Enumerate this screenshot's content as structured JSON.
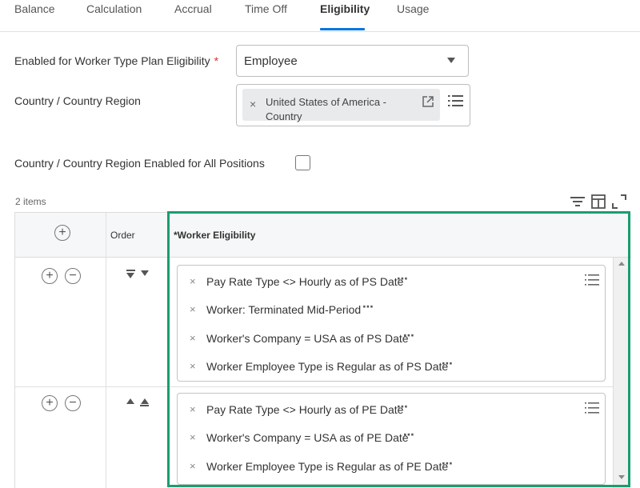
{
  "tabs": [
    {
      "label": "Balance"
    },
    {
      "label": "Calculation"
    },
    {
      "label": "Accrual"
    },
    {
      "label": "Time Off"
    },
    {
      "label": "Eligibility",
      "active": true
    },
    {
      "label": "Usage"
    }
  ],
  "form": {
    "worker_type_label": "Enabled for Worker Type Plan Eligibility",
    "required_mark": "*",
    "worker_type_value": "Employee",
    "country_label": "Country / Country Region",
    "country_pill": "United States of America - Country",
    "all_positions_label": "Country / Country Region Enabled for All Positions",
    "all_positions_checked": false
  },
  "grid": {
    "item_count": "2 items",
    "columns": {
      "add": "",
      "order": "Order",
      "eligibility": "*Worker Eligibility"
    },
    "rows": [
      {
        "order_icons": [
          "move-to-bottom",
          "move-down"
        ],
        "conditions": [
          "Pay Rate Type <> Hourly as of PS Date",
          "Worker: Terminated Mid-Period",
          "Worker's Company = USA as of PS Date",
          "Worker Employee Type is Regular as of PS Date"
        ]
      },
      {
        "order_icons": [
          "move-up",
          "move-to-top"
        ],
        "conditions": [
          "Pay Rate Type <> Hourly as of PE Date",
          "Worker's Company = USA as of PE Date",
          "Worker Employee Type is Regular as of PE Date"
        ]
      }
    ]
  },
  "colors": {
    "accent": "#0875e1",
    "highlight": "#1a9e6e",
    "required": "#de2e21"
  },
  "icons": {
    "remove": "×",
    "more": "⋯",
    "add": "+",
    "minus": "−"
  }
}
